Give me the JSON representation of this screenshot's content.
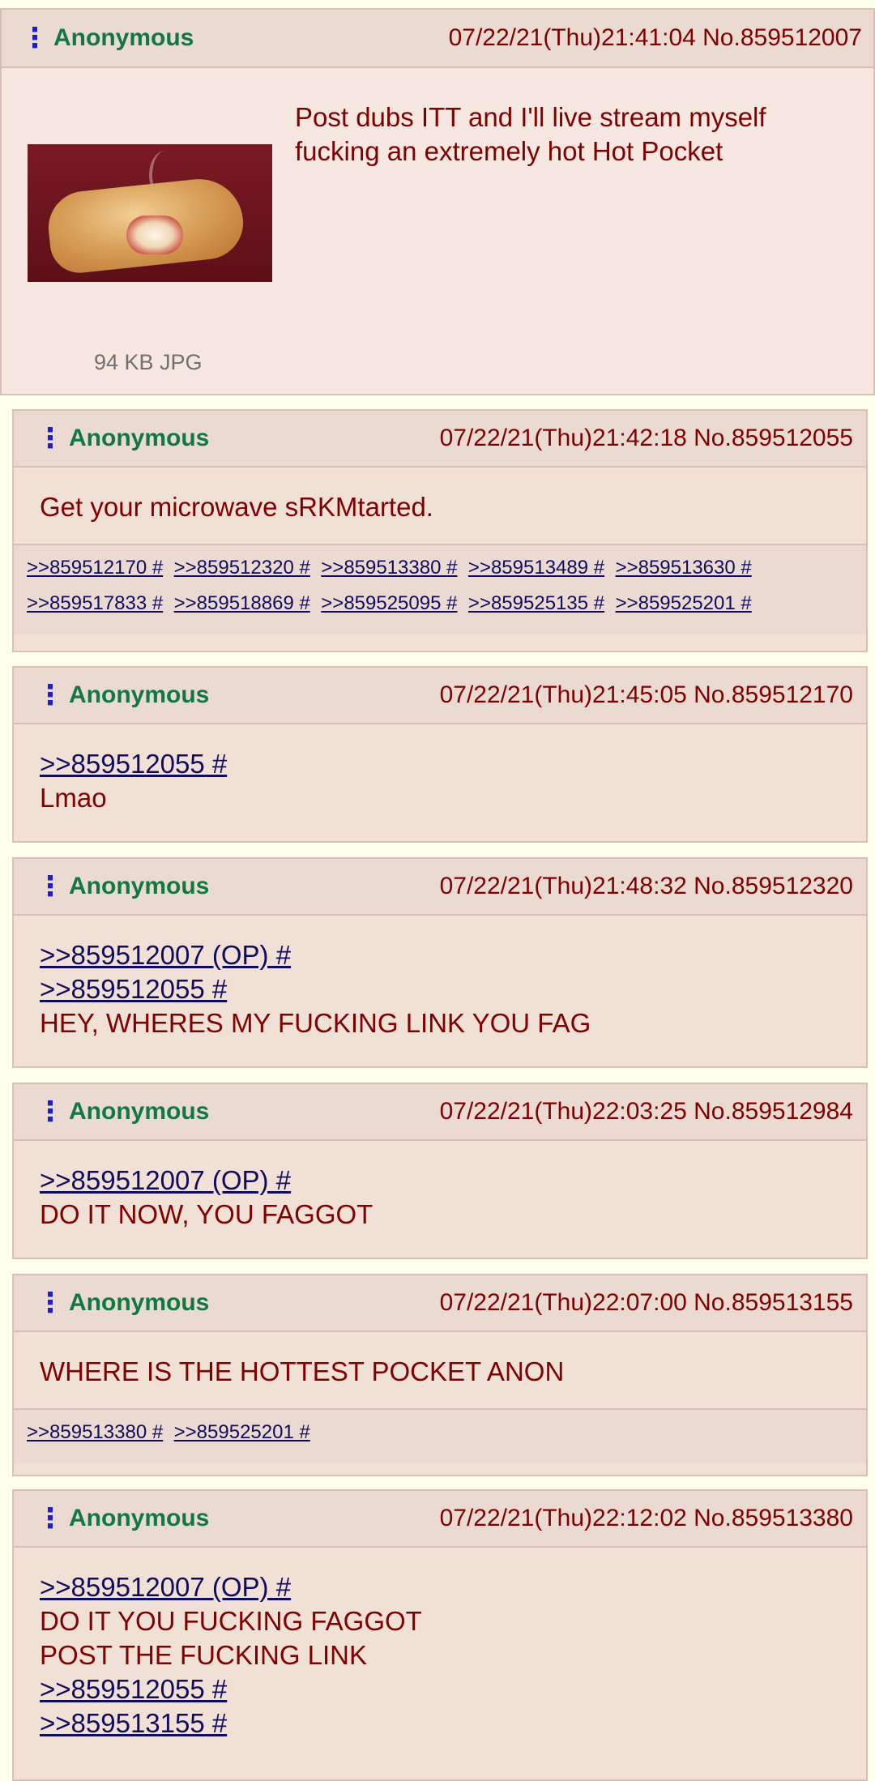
{
  "op": {
    "menu_icon": "vertical-dots-icon",
    "name": "Anonymous",
    "meta": "07/22/21(Thu)21:41:04 No.859512007",
    "subject": "Post dubs ITT and I'll live stream myself fucking an extremely hot Hot Pocket",
    "file_info": "94 KB JPG"
  },
  "replies": [
    {
      "name": "Anonymous",
      "meta": "07/22/21(Thu)21:42:18 No.859512055",
      "text": "Get your microwave sRKMtarted.",
      "backlinks": [
        ">>859512170 #",
        ">>859512320 #",
        ">>859513380 #",
        ">>859513489 #",
        ">>859513630 #",
        ">>859517833 #",
        ">>859518869 #",
        ">>859525095 #",
        ">>859525135 #",
        ">>859525201 #"
      ]
    },
    {
      "name": "Anonymous",
      "meta": "07/22/21(Thu)21:45:05 No.859512170",
      "quote1": ">>859512055 #",
      "text": "Lmao"
    },
    {
      "name": "Anonymous",
      "meta": "07/22/21(Thu)21:48:32 No.859512320",
      "quote1": ">>859512007 (OP) #",
      "quote2": ">>859512055 #",
      "text": "HEY, WHERES MY FUCKING LINK YOU FAG"
    },
    {
      "name": "Anonymous",
      "meta": "07/22/21(Thu)22:03:25 No.859512984",
      "quote1": ">>859512007 (OP) #",
      "text": "DO IT NOW, YOU FAGGOT"
    },
    {
      "name": "Anonymous",
      "meta": "07/22/21(Thu)22:07:00 No.859513155",
      "text": "WHERE IS THE HOTTEST POCKET ANON",
      "backlinks": [
        ">>859513380 #",
        ">>859525201 #"
      ]
    },
    {
      "name": "Anonymous",
      "meta": "07/22/21(Thu)22:12:02 No.859513380",
      "quote1": ">>859512007 (OP) #",
      "text1": "DO IT YOU FUCKING FAGGOT",
      "text2": "POST THE FUCKING LINK",
      "quote2": ">>859512055 #",
      "quote3": ">>859513155 #"
    }
  ]
}
